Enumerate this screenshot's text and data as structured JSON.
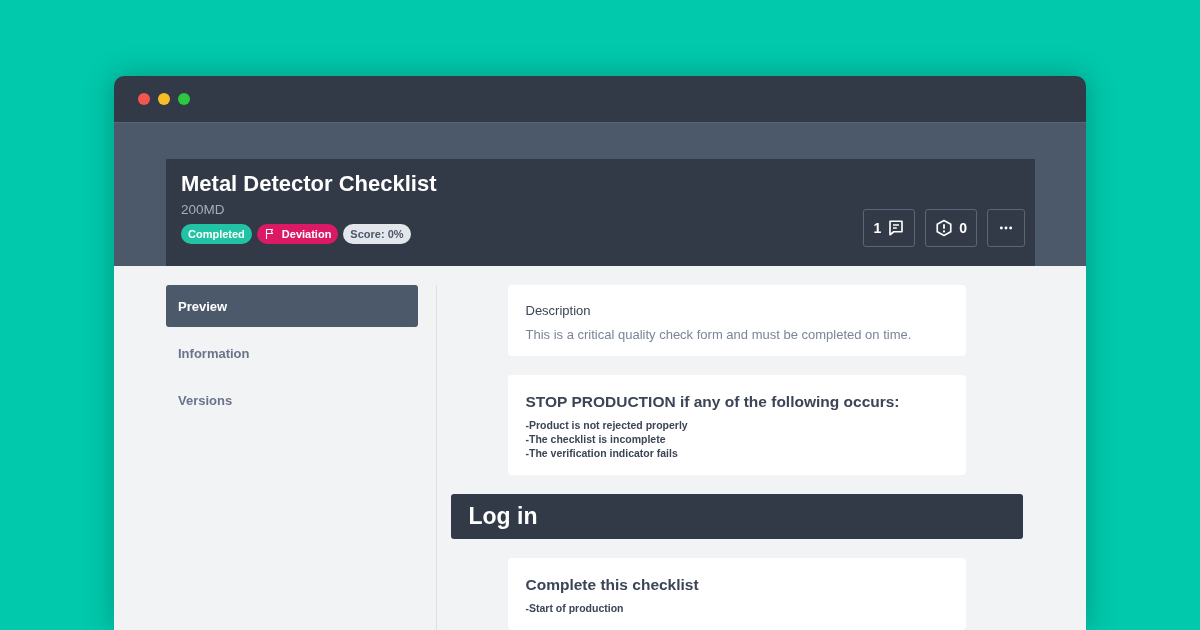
{
  "checklist": {
    "title": "Metal Detector Checklist",
    "code": "200MD",
    "badges": [
      {
        "kind": "status",
        "label": "Completed"
      },
      {
        "kind": "flag",
        "label": "Deviation"
      },
      {
        "kind": "score",
        "label": "Score: 0%"
      }
    ],
    "actions": [
      {
        "kind": "comments",
        "label": "1"
      },
      {
        "kind": "issues",
        "label": "0"
      },
      {
        "kind": "more"
      }
    ]
  },
  "sidebar": {
    "items": [
      {
        "label": "Preview",
        "selected": true
      },
      {
        "label": "Information",
        "selected": false
      },
      {
        "label": "Versions",
        "selected": false
      }
    ]
  },
  "content": [
    {
      "kind": "description",
      "heading": "Description",
      "text": "This is a critical quality check form and must be completed on time."
    },
    {
      "kind": "instructions",
      "heading": "STOP PRODUCTION if any of the following occurs:",
      "lines": [
        "-Product is not rejected properly",
        "-The checklist is incomplete",
        "-The verification indicator fails"
      ]
    },
    {
      "kind": "section",
      "heading": "Log in"
    },
    {
      "kind": "instructions",
      "heading": "Complete this checklist",
      "lines": [
        "-Start of production"
      ]
    }
  ]
}
